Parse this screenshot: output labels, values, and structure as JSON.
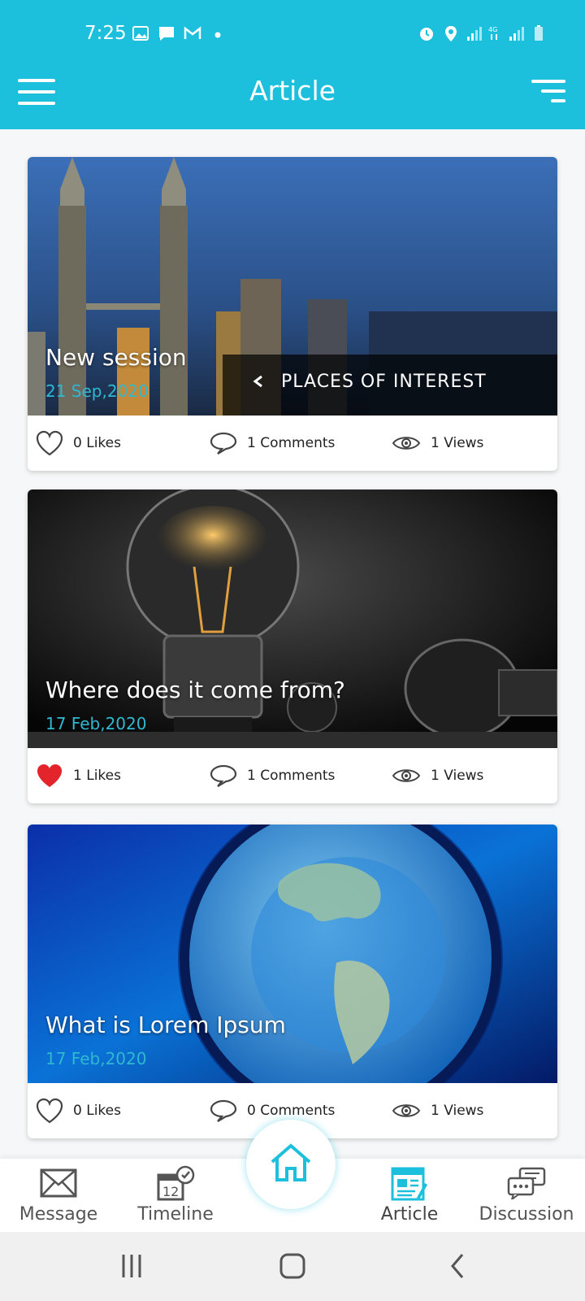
{
  "status_bar": {
    "time": "7:25"
  },
  "app_bar": {
    "title": "Article"
  },
  "articles": [
    {
      "title": "New session",
      "date": "21 Sep,2020",
      "image_caption": "PLACES OF INTEREST",
      "likes": "0 Likes",
      "comments": "1 Comments",
      "views": "1 Views",
      "liked": false
    },
    {
      "title": "Where does it come from?",
      "date": "17 Feb,2020",
      "likes": "1 Likes",
      "comments": "1 Comments",
      "views": "1 Views",
      "liked": true
    },
    {
      "title": "What is Lorem Ipsum",
      "date": "17 Feb,2020",
      "likes": "0 Likes",
      "comments": "0 Comments",
      "views": "1 Views",
      "liked": false
    }
  ],
  "bottom_nav": {
    "items": [
      {
        "label": "Message",
        "icon": "envelope-icon"
      },
      {
        "label": "Timeline",
        "icon": "calendar-icon"
      },
      {
        "label": "Home",
        "icon": "home-icon"
      },
      {
        "label": "Article",
        "icon": "article-icon"
      },
      {
        "label": "Discussion",
        "icon": "chat-icon"
      }
    ],
    "active": "Article"
  },
  "colors": {
    "primary": "#1cc0dc",
    "date_text": "#2fb8d0",
    "liked_heart": "#e3242b",
    "background": "#f6f7f8"
  }
}
